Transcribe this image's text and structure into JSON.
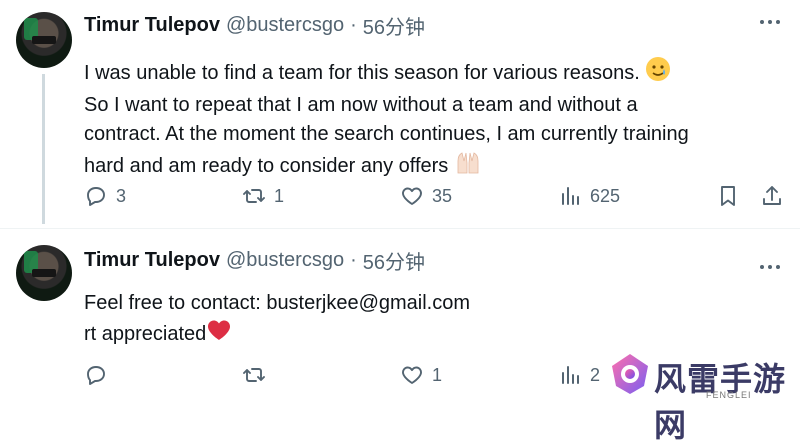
{
  "tweets": [
    {
      "author_name": "Timur Tulepov",
      "handle": "@bustercsgo",
      "separator": "·",
      "time": "56分钟",
      "lines": [
        "I was unable to find a team for this season for various reasons.",
        "So I want to repeat that I am now without a team and without a",
        "contract. At the moment the search continues, I am currently training",
        "hard and am ready to consider any offers"
      ],
      "emoji_after_line1": "smiling-face-with-tear",
      "emoji_after_line4": "raising-hands",
      "replies": "3",
      "reposts": "1",
      "likes": "35",
      "views": "625"
    },
    {
      "author_name": "Timur Tulepov",
      "handle": "@bustercsgo",
      "separator": "·",
      "time": "56分钟",
      "lines": [
        "Feel free to contact: busterjkee@gmail.com",
        "rt appreciated"
      ],
      "emoji_after_line2": "red-heart",
      "replies": "",
      "reposts": "",
      "likes": "1",
      "views": "2"
    }
  ],
  "icons": [
    "reply-icon",
    "repost-icon",
    "like-icon",
    "views-icon",
    "bookmark-icon",
    "share-icon",
    "more-icon"
  ],
  "colors": {
    "text": "#0f1419",
    "secondary": "#536471",
    "heart": "#e0245e"
  },
  "watermark": {
    "text": "风雷手游网",
    "subtext": "FENGLEI"
  }
}
